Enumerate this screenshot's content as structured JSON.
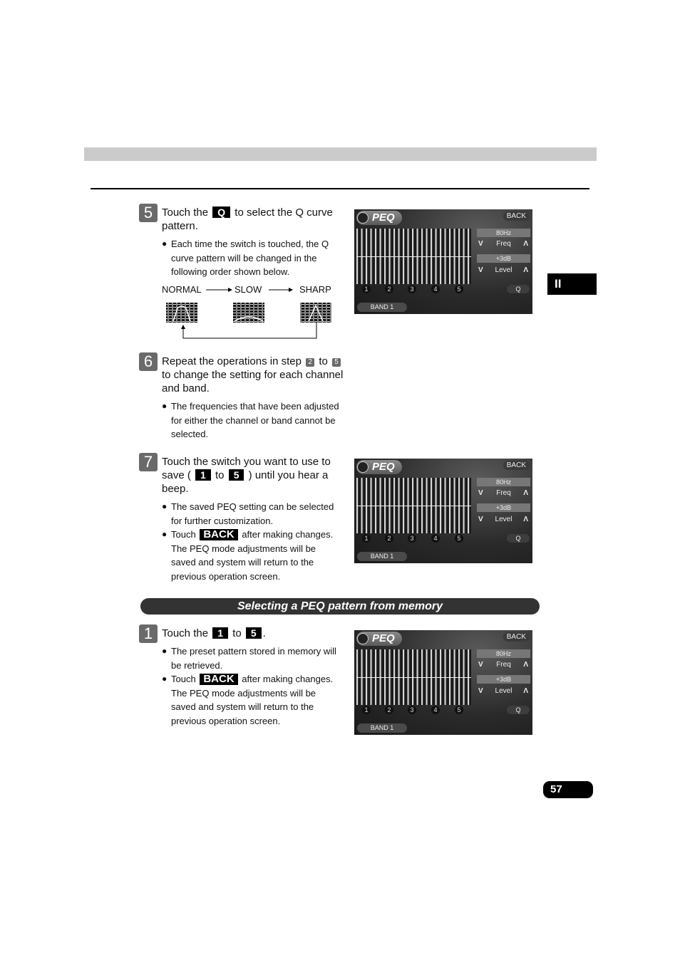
{
  "page": {
    "chapter_tab": "II",
    "page_number": "57"
  },
  "steps": {
    "step5": {
      "number": "5",
      "text_before": "Touch the",
      "key": "Q",
      "text_after": "to select the Q curve pattern.",
      "bullets": [
        "Each time the switch is touched, the Q curve pattern will be changed in the following order shown below."
      ],
      "q_sequence": {
        "labels": [
          "NORMAL",
          "SLOW",
          "SHARP"
        ]
      }
    },
    "step6": {
      "number": "6",
      "text_a": "Repeat the operations in step",
      "ref_from": "2",
      "text_b": "to",
      "ref_to": "5",
      "text_c": "to change the setting for each channel and band.",
      "bullets": [
        "The frequencies that have been adjusted for either the channel or band cannot be selected."
      ]
    },
    "step7": {
      "number": "7",
      "text_a": "Touch the switch you want to use to save (",
      "key_from": "1",
      "text_b": "to",
      "key_to": "5",
      "text_c": ") until you hear a beep.",
      "bullets": [
        "The saved PEQ setting can be selected for further customization."
      ],
      "bullet_back": {
        "prefix": "Touch",
        "key": "BACK",
        "suffix": "after making changes. The PEQ mode adjustments will be saved and system will return to the previous operation screen."
      }
    }
  },
  "section": {
    "title": "Selecting a PEQ pattern from memory",
    "step1": {
      "number": "1",
      "text_a": "Touch the",
      "key_from": "1",
      "text_b": "to",
      "key_to": "5",
      "text_c": ".",
      "bullets": [
        "The preset pattern stored in memory will be retrieved."
      ],
      "bullet_back": {
        "prefix": "Touch",
        "key": "BACK",
        "suffix": "after making changes. The PEQ mode adjustments will be saved and system will return to the previous operation screen."
      }
    }
  },
  "peq_screen": {
    "title": "PEQ",
    "back": "BACK",
    "freq_value": "80Hz",
    "freq_label": "Freq",
    "level_value": "+3dB",
    "level_label": "Level",
    "down_glyph": "V",
    "up_glyph": "Λ",
    "memory_buttons": [
      "1",
      "2",
      "3",
      "4",
      "5"
    ],
    "q_button": "Q",
    "band_button": "BAND 1"
  }
}
